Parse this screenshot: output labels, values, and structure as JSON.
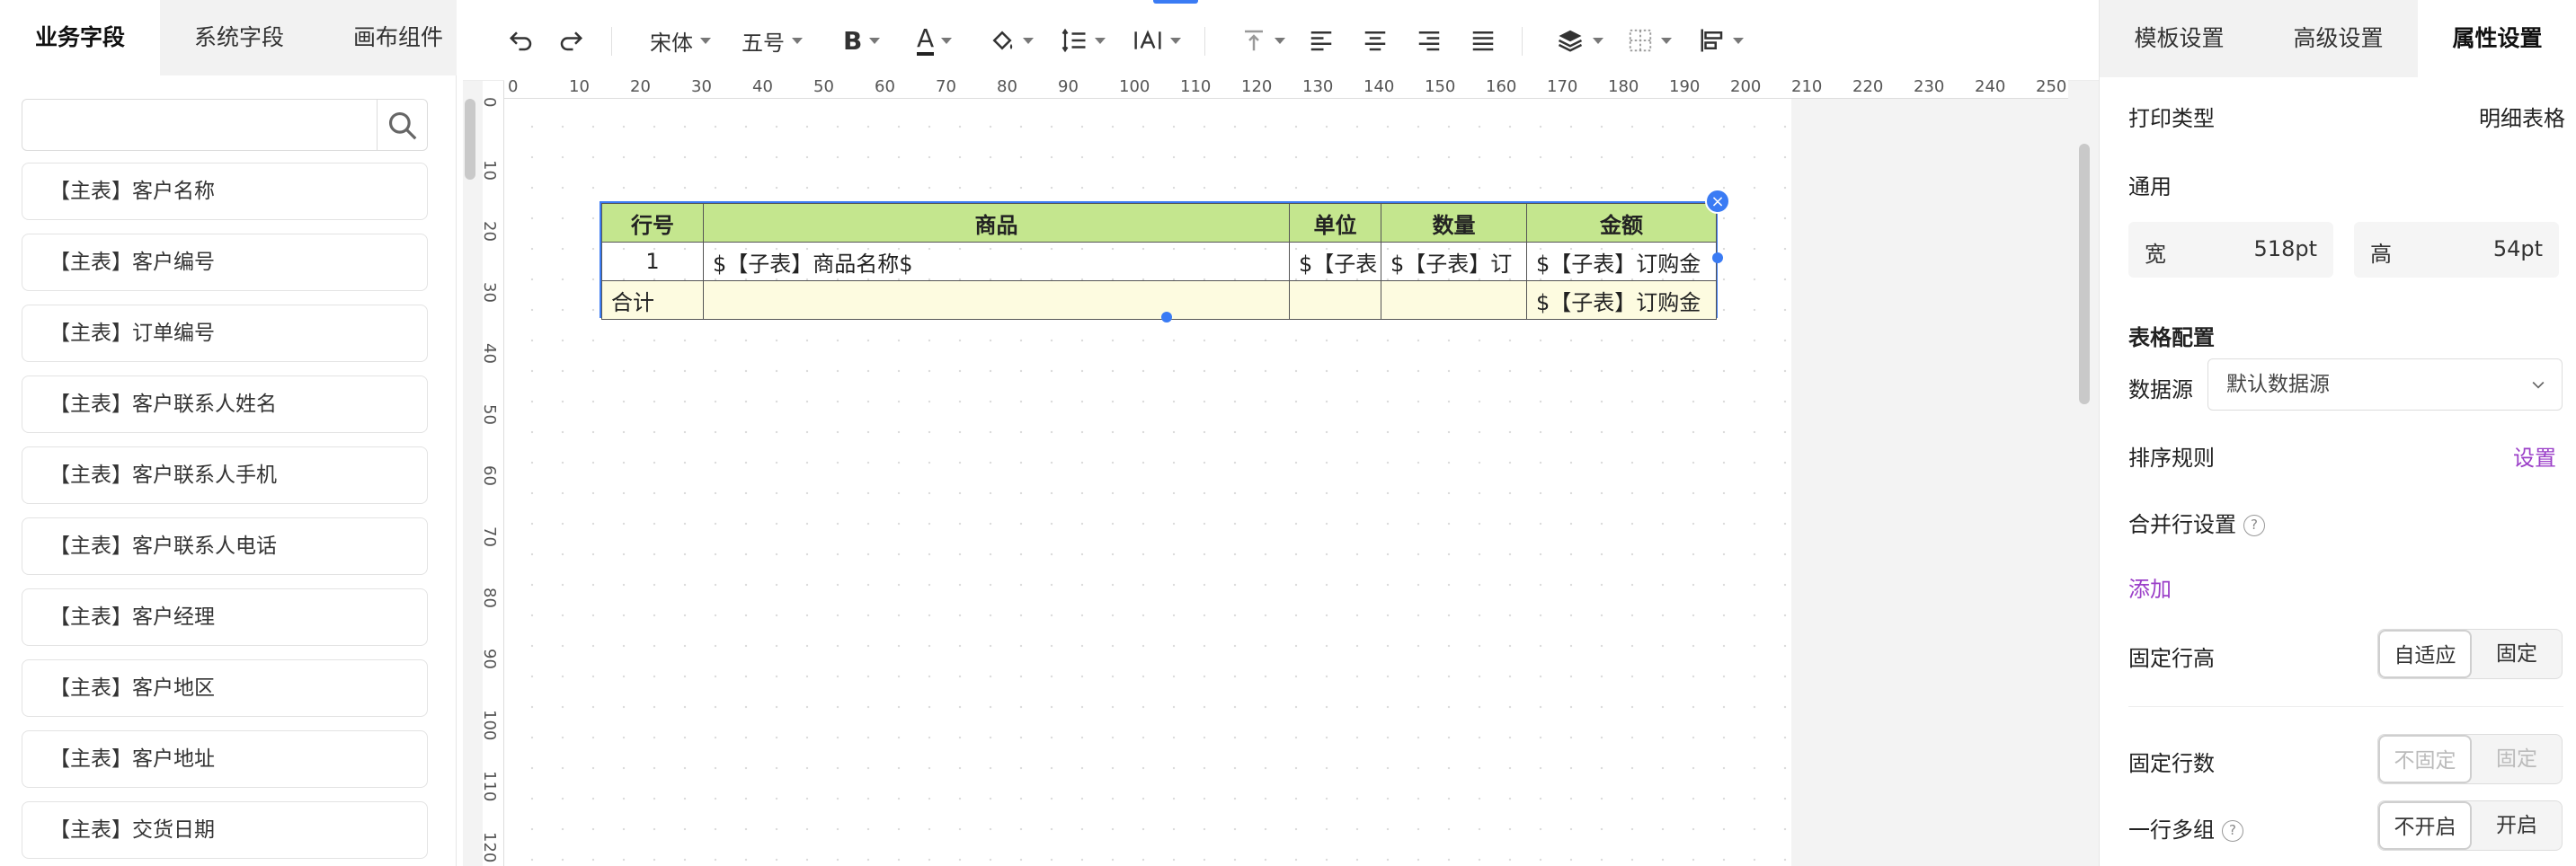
{
  "left_panel": {
    "tabs": [
      "业务字段",
      "系统字段",
      "画布组件"
    ],
    "search": {
      "placeholder": ""
    },
    "fields": [
      "【主表】客户名称",
      "【主表】客户编号",
      "【主表】订单编号",
      "【主表】客户联系人姓名",
      "【主表】客户联系人手机",
      "【主表】客户联系人电话",
      "【主表】客户经理",
      "【主表】客户地区",
      "【主表】客户地址",
      "【主表】交货日期"
    ]
  },
  "toolbar": {
    "font_family": "宋体",
    "font_size": "五号",
    "bold": "B",
    "font_color": "A"
  },
  "ruler": {
    "top": [
      "0",
      "10",
      "20",
      "30",
      "40",
      "50",
      "60",
      "70",
      "80",
      "90",
      "100",
      "110",
      "120",
      "130",
      "140",
      "150",
      "160",
      "170",
      "180",
      "190",
      "200",
      "210",
      "220",
      "230",
      "240",
      "250"
    ],
    "left": [
      "0",
      "10",
      "20",
      "30",
      "40",
      "50",
      "60",
      "70",
      "80",
      "90",
      "100",
      "110",
      "120"
    ]
  },
  "table": {
    "headers": [
      "行号",
      "商品",
      "单位",
      "数量",
      "金额"
    ],
    "row": [
      "1",
      "$【子表】商品名称$",
      "$【子表",
      "$【子表】订",
      "$【子表】订购金"
    ],
    "summary": [
      "合计",
      "",
      "",
      "",
      "$【子表】订购金"
    ],
    "header_color": "#c4e68e",
    "summary_color": "#fdfbe0",
    "selection_color": "#3a7bf4"
  },
  "right_panel": {
    "tabs": [
      "模板设置",
      "高级设置",
      "属性设置"
    ],
    "print_type_label": "打印类型",
    "print_type_value": "明细表格",
    "general_label": "通用",
    "width_label": "宽",
    "width_value": "518pt",
    "height_label": "高",
    "height_value": "54pt",
    "table_config_label": "表格配置",
    "datasource_label": "数据源",
    "datasource_value": "默认数据源",
    "sort_label": "排序规则",
    "sort_action": "设置",
    "merge_label": "合并行设置",
    "merge_action": "添加",
    "row_height_label": "固定行高",
    "row_height_options": [
      "自适应",
      "固定"
    ],
    "row_count_label": "固定行数",
    "row_count_options": [
      "不固定",
      "固定"
    ],
    "group_label": "一行多组",
    "group_options": [
      "不开启",
      "开启"
    ],
    "accent_color": "#9b3fc8"
  }
}
